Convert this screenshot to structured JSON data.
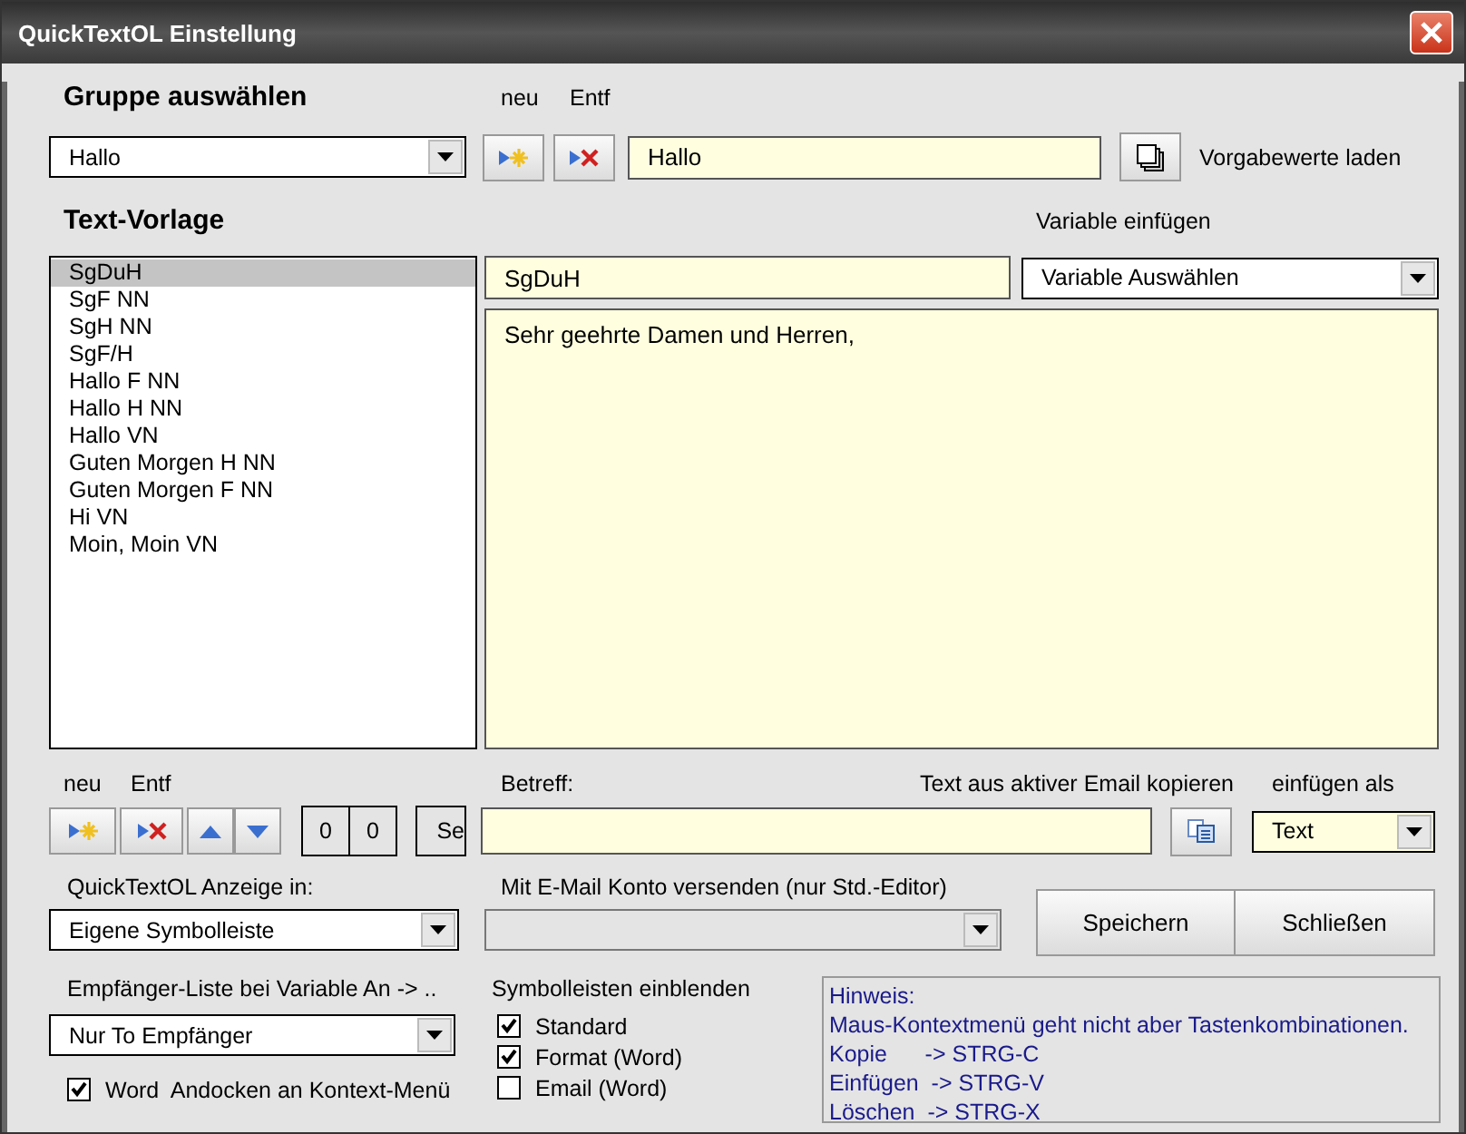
{
  "window": {
    "title": "QuickTextOL Einstellung"
  },
  "group": {
    "heading": "Gruppe auswählen",
    "new_label": "neu",
    "delete_label": "Entf",
    "select": "Hallo",
    "name_field": "Hallo",
    "load_defaults_label": "Vorgabewerte laden"
  },
  "templates": {
    "heading": "Text-Vorlage",
    "variable_label": "Variable einfügen",
    "items": [
      {
        "label": "SgDuH",
        "selected": true
      },
      {
        "label": "SgF NN",
        "selected": false
      },
      {
        "label": "SgH NN",
        "selected": false
      },
      {
        "label": "SgF/H",
        "selected": false
      },
      {
        "label": "Hallo F NN",
        "selected": false
      },
      {
        "label": "Hallo H NN",
        "selected": false
      },
      {
        "label": "Hallo VN",
        "selected": false
      },
      {
        "label": "Guten Morgen H NN",
        "selected": false
      },
      {
        "label": "Guten Morgen F NN",
        "selected": false
      },
      {
        "label": "Hi VN",
        "selected": false
      },
      {
        "label": "Moin, Moin VN",
        "selected": false
      }
    ],
    "name_field": "SgDuH",
    "variable_select": "Variable Auswählen",
    "body": "Sehr geehrte Damen und Herren,"
  },
  "toolbar": {
    "new_label": "neu",
    "delete_label": "Entf",
    "counters": [
      "0",
      "0"
    ],
    "cut_button": "Se"
  },
  "subject": {
    "label": "Betreff:",
    "copy_label": "Text aus aktiver Email kopieren",
    "insert_as_label": "einfügen als",
    "insert_as_select": "Text"
  },
  "display": {
    "label": "QuickTextOL Anzeige in:",
    "select": "Eigene Symbolleiste"
  },
  "account": {
    "label": "Mit E-Mail Konto versenden (nur Std.-Editor)",
    "disabled": true
  },
  "buttons": [
    "Speichern",
    "Schließen"
  ],
  "recipients": {
    "label": "Empfänger-Liste bei Variable An -> ..",
    "select": "Nur To Empfänger"
  },
  "word_dock": {
    "label": "Word  Andocken an Kontext-Menü",
    "checked": true
  },
  "toolbars": {
    "heading": "Symbolleisten einblenden",
    "items": [
      {
        "label": "Standard",
        "checked": true
      },
      {
        "label": "Format (Word)",
        "checked": true
      },
      {
        "label": "Email (Word)",
        "checked": false
      }
    ]
  },
  "hint": {
    "lines": [
      "Hinweis:",
      "Maus-Kontextmenü geht nicht aber Tastenkombinationen.",
      "Kopie      -> STRG-C",
      "Einfügen  -> STRG-V",
      "Löschen  -> STRG-X"
    ]
  }
}
